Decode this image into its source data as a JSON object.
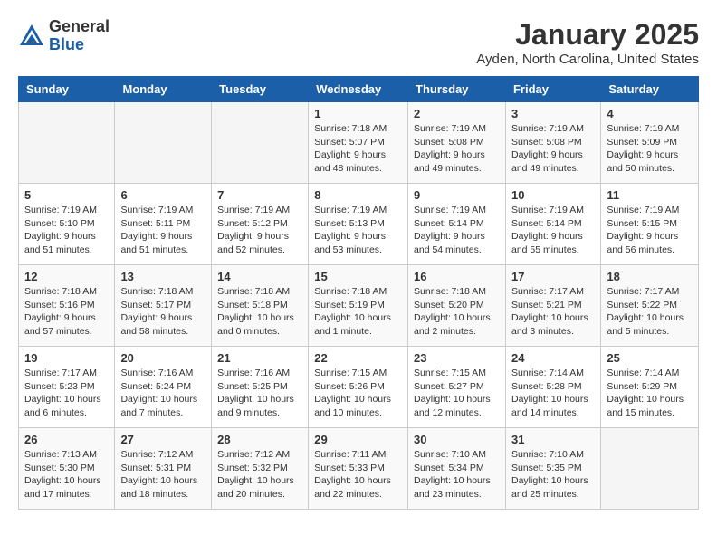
{
  "header": {
    "logo_general": "General",
    "logo_blue": "Blue",
    "title": "January 2025",
    "location": "Ayden, North Carolina, United States"
  },
  "weekdays": [
    "Sunday",
    "Monday",
    "Tuesday",
    "Wednesday",
    "Thursday",
    "Friday",
    "Saturday"
  ],
  "weeks": [
    [
      {
        "day": "",
        "info": ""
      },
      {
        "day": "",
        "info": ""
      },
      {
        "day": "",
        "info": ""
      },
      {
        "day": "1",
        "info": "Sunrise: 7:18 AM\nSunset: 5:07 PM\nDaylight: 9 hours\nand 48 minutes."
      },
      {
        "day": "2",
        "info": "Sunrise: 7:19 AM\nSunset: 5:08 PM\nDaylight: 9 hours\nand 49 minutes."
      },
      {
        "day": "3",
        "info": "Sunrise: 7:19 AM\nSunset: 5:08 PM\nDaylight: 9 hours\nand 49 minutes."
      },
      {
        "day": "4",
        "info": "Sunrise: 7:19 AM\nSunset: 5:09 PM\nDaylight: 9 hours\nand 50 minutes."
      }
    ],
    [
      {
        "day": "5",
        "info": "Sunrise: 7:19 AM\nSunset: 5:10 PM\nDaylight: 9 hours\nand 51 minutes."
      },
      {
        "day": "6",
        "info": "Sunrise: 7:19 AM\nSunset: 5:11 PM\nDaylight: 9 hours\nand 51 minutes."
      },
      {
        "day": "7",
        "info": "Sunrise: 7:19 AM\nSunset: 5:12 PM\nDaylight: 9 hours\nand 52 minutes."
      },
      {
        "day": "8",
        "info": "Sunrise: 7:19 AM\nSunset: 5:13 PM\nDaylight: 9 hours\nand 53 minutes."
      },
      {
        "day": "9",
        "info": "Sunrise: 7:19 AM\nSunset: 5:14 PM\nDaylight: 9 hours\nand 54 minutes."
      },
      {
        "day": "10",
        "info": "Sunrise: 7:19 AM\nSunset: 5:14 PM\nDaylight: 9 hours\nand 55 minutes."
      },
      {
        "day": "11",
        "info": "Sunrise: 7:19 AM\nSunset: 5:15 PM\nDaylight: 9 hours\nand 56 minutes."
      }
    ],
    [
      {
        "day": "12",
        "info": "Sunrise: 7:18 AM\nSunset: 5:16 PM\nDaylight: 9 hours\nand 57 minutes."
      },
      {
        "day": "13",
        "info": "Sunrise: 7:18 AM\nSunset: 5:17 PM\nDaylight: 9 hours\nand 58 minutes."
      },
      {
        "day": "14",
        "info": "Sunrise: 7:18 AM\nSunset: 5:18 PM\nDaylight: 10 hours\nand 0 minutes."
      },
      {
        "day": "15",
        "info": "Sunrise: 7:18 AM\nSunset: 5:19 PM\nDaylight: 10 hours\nand 1 minute."
      },
      {
        "day": "16",
        "info": "Sunrise: 7:18 AM\nSunset: 5:20 PM\nDaylight: 10 hours\nand 2 minutes."
      },
      {
        "day": "17",
        "info": "Sunrise: 7:17 AM\nSunset: 5:21 PM\nDaylight: 10 hours\nand 3 minutes."
      },
      {
        "day": "18",
        "info": "Sunrise: 7:17 AM\nSunset: 5:22 PM\nDaylight: 10 hours\nand 5 minutes."
      }
    ],
    [
      {
        "day": "19",
        "info": "Sunrise: 7:17 AM\nSunset: 5:23 PM\nDaylight: 10 hours\nand 6 minutes."
      },
      {
        "day": "20",
        "info": "Sunrise: 7:16 AM\nSunset: 5:24 PM\nDaylight: 10 hours\nand 7 minutes."
      },
      {
        "day": "21",
        "info": "Sunrise: 7:16 AM\nSunset: 5:25 PM\nDaylight: 10 hours\nand 9 minutes."
      },
      {
        "day": "22",
        "info": "Sunrise: 7:15 AM\nSunset: 5:26 PM\nDaylight: 10 hours\nand 10 minutes."
      },
      {
        "day": "23",
        "info": "Sunrise: 7:15 AM\nSunset: 5:27 PM\nDaylight: 10 hours\nand 12 minutes."
      },
      {
        "day": "24",
        "info": "Sunrise: 7:14 AM\nSunset: 5:28 PM\nDaylight: 10 hours\nand 14 minutes."
      },
      {
        "day": "25",
        "info": "Sunrise: 7:14 AM\nSunset: 5:29 PM\nDaylight: 10 hours\nand 15 minutes."
      }
    ],
    [
      {
        "day": "26",
        "info": "Sunrise: 7:13 AM\nSunset: 5:30 PM\nDaylight: 10 hours\nand 17 minutes."
      },
      {
        "day": "27",
        "info": "Sunrise: 7:12 AM\nSunset: 5:31 PM\nDaylight: 10 hours\nand 18 minutes."
      },
      {
        "day": "28",
        "info": "Sunrise: 7:12 AM\nSunset: 5:32 PM\nDaylight: 10 hours\nand 20 minutes."
      },
      {
        "day": "29",
        "info": "Sunrise: 7:11 AM\nSunset: 5:33 PM\nDaylight: 10 hours\nand 22 minutes."
      },
      {
        "day": "30",
        "info": "Sunrise: 7:10 AM\nSunset: 5:34 PM\nDaylight: 10 hours\nand 23 minutes."
      },
      {
        "day": "31",
        "info": "Sunrise: 7:10 AM\nSunset: 5:35 PM\nDaylight: 10 hours\nand 25 minutes."
      },
      {
        "day": "",
        "info": ""
      }
    ]
  ]
}
